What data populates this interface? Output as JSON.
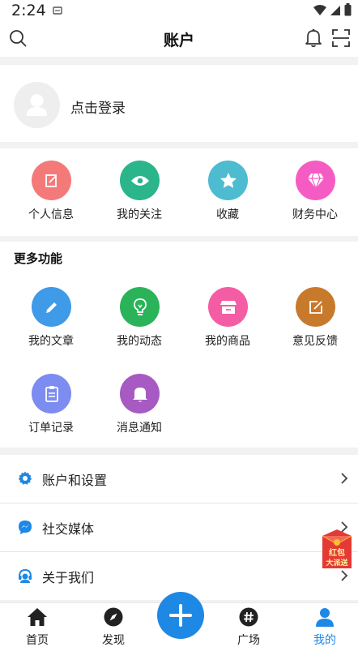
{
  "status_bar": {
    "time": "2:24"
  },
  "header": {
    "title": "账户"
  },
  "login": {
    "text": "点击登录"
  },
  "quick_actions": [
    {
      "label": "个人信息",
      "icon": "edit-icon",
      "color": "#f47a7a"
    },
    {
      "label": "我的关注",
      "icon": "eye-icon",
      "color": "#2bb58a"
    },
    {
      "label": "收藏",
      "icon": "star-icon",
      "color": "#4dbcd0"
    },
    {
      "label": "财务中心",
      "icon": "diamond-icon",
      "color": "#f45cc4"
    }
  ],
  "more": {
    "title": "更多功能",
    "items": [
      {
        "label": "我的文章",
        "icon": "pencil-icon",
        "color": "#3f9ae8"
      },
      {
        "label": "我的动态",
        "icon": "bulb-icon",
        "color": "#2bb35a"
      },
      {
        "label": "我的商品",
        "icon": "shop-icon",
        "color": "#f45ca4"
      },
      {
        "label": "意见反馈",
        "icon": "feedback-icon",
        "color": "#c87a2c"
      },
      {
        "label": "订单记录",
        "icon": "clipboard-icon",
        "color": "#7c8cf0"
      },
      {
        "label": "消息通知",
        "icon": "bell-icon",
        "color": "#a75ac2"
      }
    ]
  },
  "menu": [
    {
      "label": "账户和设置",
      "icon": "gear-icon"
    },
    {
      "label": "社交媒体",
      "icon": "messenger-icon"
    },
    {
      "label": "关于我们",
      "icon": "support-icon"
    }
  ],
  "promo": {
    "line1": "红包",
    "line2": "大派送"
  },
  "bottom_nav": [
    {
      "label": "首页",
      "icon": "home-icon"
    },
    {
      "label": "发现",
      "icon": "compass-icon"
    },
    {
      "label": "广场",
      "icon": "hashtag-icon"
    },
    {
      "label": "我的",
      "icon": "person-icon",
      "active": true
    }
  ],
  "colors": {
    "accent": "#1e88e5"
  }
}
